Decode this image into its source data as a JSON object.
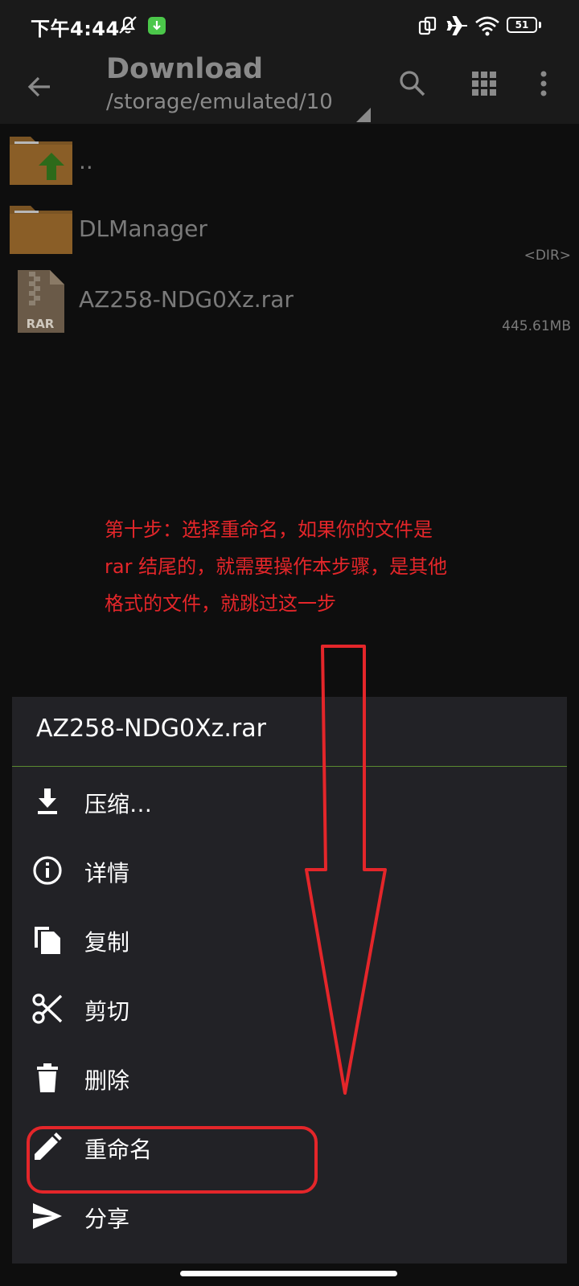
{
  "status_bar": {
    "time": "下午4:44",
    "battery": "51"
  },
  "toolbar": {
    "title": "Download",
    "path": "/storage/emulated/10",
    "icons": [
      "back-arrow-icon",
      "search-icon",
      "grid-view-icon",
      "more-vert-icon"
    ]
  },
  "files": [
    {
      "name": "..",
      "meta": "",
      "icon": "parent-folder-icon"
    },
    {
      "name": "DLManager",
      "meta": "<DIR>",
      "icon": "folder-icon"
    },
    {
      "name": "AZ258-NDG0Xz.rar",
      "meta": "445.61MB",
      "icon": "rar-file-icon",
      "badge": "RAR"
    }
  ],
  "annotation": {
    "lines": [
      "第十步：选择重命名，如果你的文件是",
      "rar 结尾的，就需要操作本步骤，是其他",
      "格式的文件，就跳过这一步"
    ],
    "color": "#e4262a"
  },
  "sheet": {
    "title": "AZ258-NDG0Xz.rar",
    "items": [
      {
        "label": "压缩…",
        "icon": "download-icon"
      },
      {
        "label": "详情",
        "icon": "info-icon"
      },
      {
        "label": "复制",
        "icon": "copy-icon"
      },
      {
        "label": "剪切",
        "icon": "scissors-icon"
      },
      {
        "label": "删除",
        "icon": "trash-icon"
      },
      {
        "label": "重命名",
        "icon": "pencil-icon",
        "highlighted": true
      },
      {
        "label": "分享",
        "icon": "send-icon"
      }
    ]
  }
}
